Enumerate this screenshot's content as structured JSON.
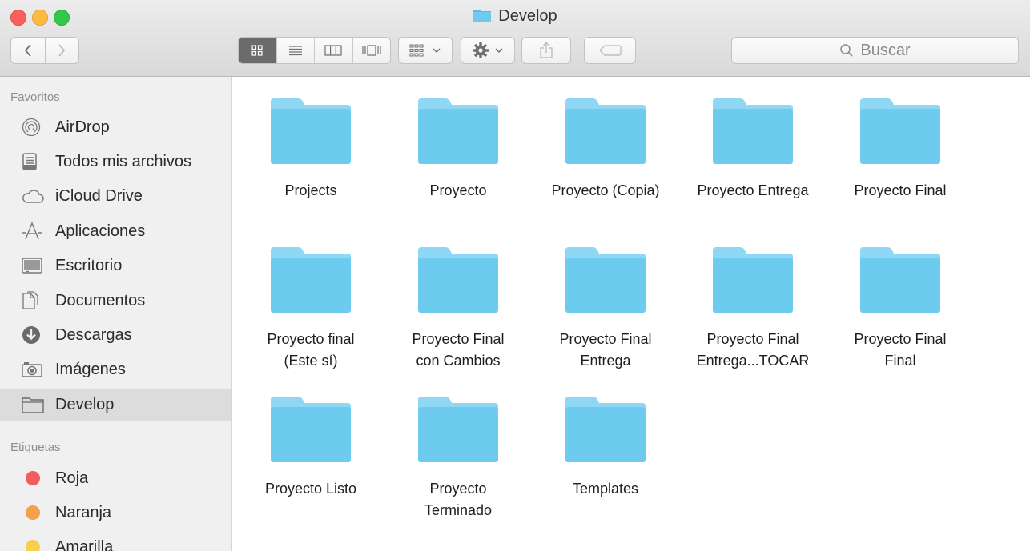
{
  "window": {
    "title": "Develop"
  },
  "toolbar": {
    "back_icon": "chevron-left-icon",
    "forward_icon": "chevron-right-icon",
    "view_modes": [
      "icon-view-icon",
      "list-view-icon",
      "column-view-icon",
      "cover-flow-icon"
    ],
    "active_view": "icon-view-icon",
    "arrange_icon": "arrange-grid-icon",
    "action_icon": "gear-icon",
    "share_icon": "share-icon",
    "tags_icon": "tag-icon",
    "search_placeholder": "Buscar"
  },
  "sidebar": {
    "favorites_header": "Favoritos",
    "favorites": [
      {
        "label": "AirDrop",
        "icon": "airdrop-icon"
      },
      {
        "label": "Todos mis archivos",
        "icon": "all-files-icon"
      },
      {
        "label": "iCloud Drive",
        "icon": "cloud-icon"
      },
      {
        "label": "Aplicaciones",
        "icon": "applications-icon"
      },
      {
        "label": "Escritorio",
        "icon": "desktop-icon"
      },
      {
        "label": "Documentos",
        "icon": "documents-icon"
      },
      {
        "label": "Descargas",
        "icon": "downloads-icon"
      },
      {
        "label": "Imágenes",
        "icon": "camera-icon"
      },
      {
        "label": "Develop",
        "icon": "folder-icon",
        "selected": true
      }
    ],
    "tags_header": "Etiquetas",
    "tags": [
      {
        "label": "Roja",
        "color": "#f25c5c"
      },
      {
        "label": "Naranja",
        "color": "#f6a04d"
      },
      {
        "label": "Amarilla",
        "color": "#f7cf4a"
      }
    ]
  },
  "folders": [
    {
      "label": "Projects"
    },
    {
      "label": "Proyecto"
    },
    {
      "label": "Proyecto (Copia)"
    },
    {
      "label": "Proyecto Entrega"
    },
    {
      "label": "Proyecto Final"
    },
    {
      "label": "Proyecto final\n(Este sí)"
    },
    {
      "label": "Proyecto Final\ncon Cambios"
    },
    {
      "label": "Proyecto Final\nEntrega"
    },
    {
      "label": "Proyecto Final\nEntrega...TOCAR"
    },
    {
      "label": "Proyecto Final\nFinal"
    },
    {
      "label": "Proyecto Listo"
    },
    {
      "label": "Proyecto\nTerminado"
    },
    {
      "label": "Templates"
    }
  ],
  "colors": {
    "folder_body": "#6ecbf0",
    "folder_tab": "#8fd8f5",
    "sidebar_bg": "#f0f0f0",
    "selected_bg": "#dcdcdc"
  }
}
